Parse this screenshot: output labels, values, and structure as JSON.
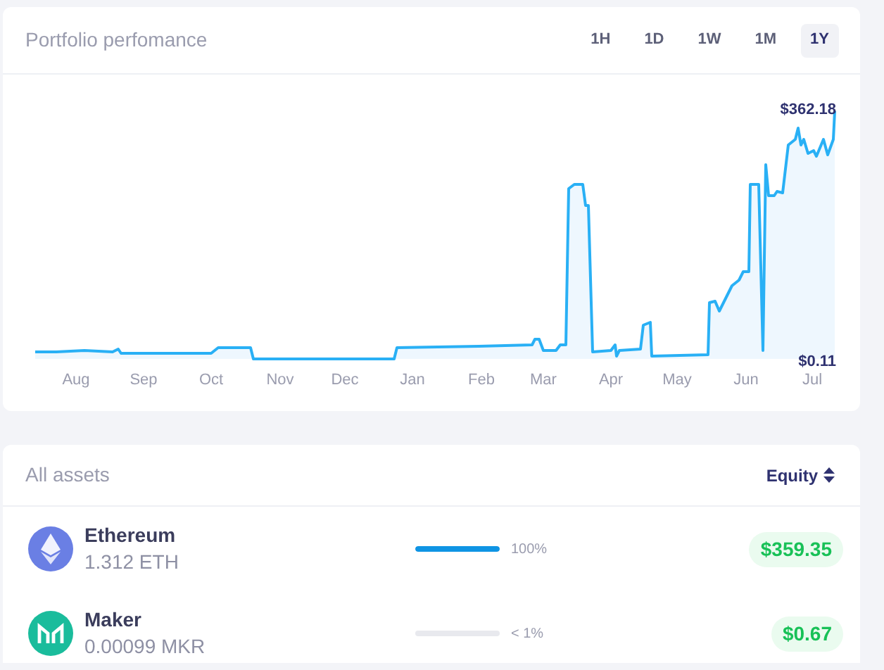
{
  "performance": {
    "title": "Portfolio perfomance",
    "ranges": [
      {
        "label": "1H",
        "selected": false
      },
      {
        "label": "1D",
        "selected": false
      },
      {
        "label": "1W",
        "selected": false
      },
      {
        "label": "1M",
        "selected": false
      },
      {
        "label": "1Y",
        "selected": true
      }
    ],
    "chart": {
      "max_label": "$362.18",
      "min_label": "$0.11",
      "months": [
        "Aug",
        "Sep",
        "Oct",
        "Nov",
        "Dec",
        "Jan",
        "Feb",
        "Mar",
        "Apr",
        "May",
        "Jun",
        "Jul"
      ]
    }
  },
  "assets": {
    "title": "All assets",
    "sort": "Equity",
    "rows": [
      {
        "kind": "ethereum",
        "name": "Ethereum",
        "amount": "1.312 ETH",
        "level": 1,
        "share": "100%",
        "value": "$359.35"
      },
      {
        "kind": "maker",
        "name": "Maker",
        "amount": "0.00099 MKR",
        "level": 0,
        "share": "< 1%",
        "value": "$0.67"
      }
    ]
  }
}
